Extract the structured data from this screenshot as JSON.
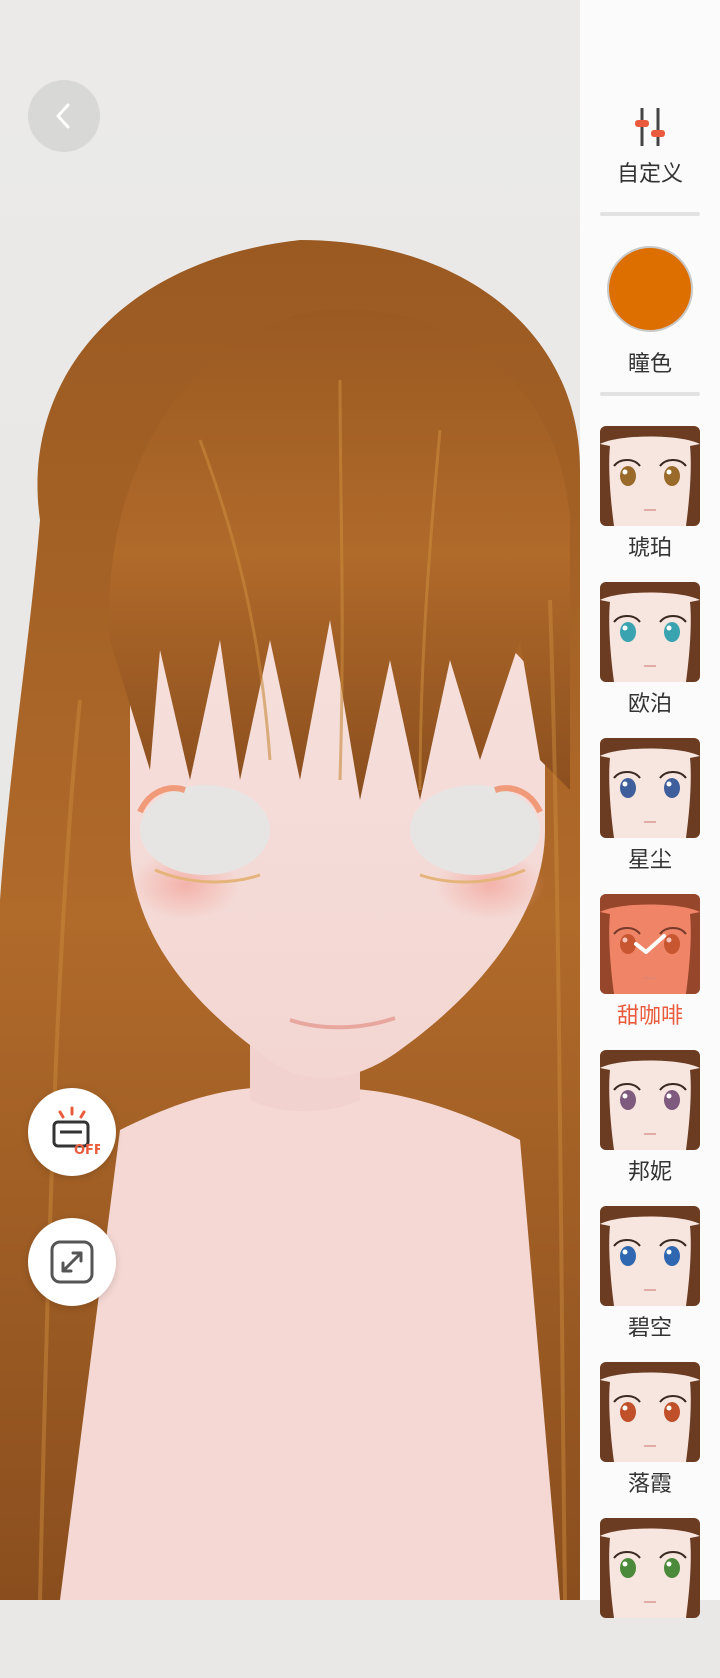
{
  "panel": {
    "custom_label": "自定义",
    "pupil_color_label": "瞳色",
    "pupil_color": "#dd6f00",
    "accent_color": "#e95b3c",
    "styles": [
      {
        "label": "琥珀",
        "iris": "#9a6a2a",
        "selected": false
      },
      {
        "label": "欧泊",
        "iris": "#3aa3b0",
        "selected": false
      },
      {
        "label": "星尘",
        "iris": "#3f5f9c",
        "selected": false
      },
      {
        "label": "甜咖啡",
        "iris": "#b5542c",
        "selected": true
      },
      {
        "label": "邦妮",
        "iris": "#7e5a7e",
        "selected": false
      },
      {
        "label": "碧空",
        "iris": "#2f67b0",
        "selected": false
      },
      {
        "label": "落霞",
        "iris": "#c0502a",
        "selected": false
      },
      {
        "label": "",
        "iris": "#4a8a3a",
        "selected": false
      }
    ]
  },
  "controls": {
    "back": "back-arrow",
    "light_toggle": "OFF",
    "expand": "expand-arrows"
  }
}
